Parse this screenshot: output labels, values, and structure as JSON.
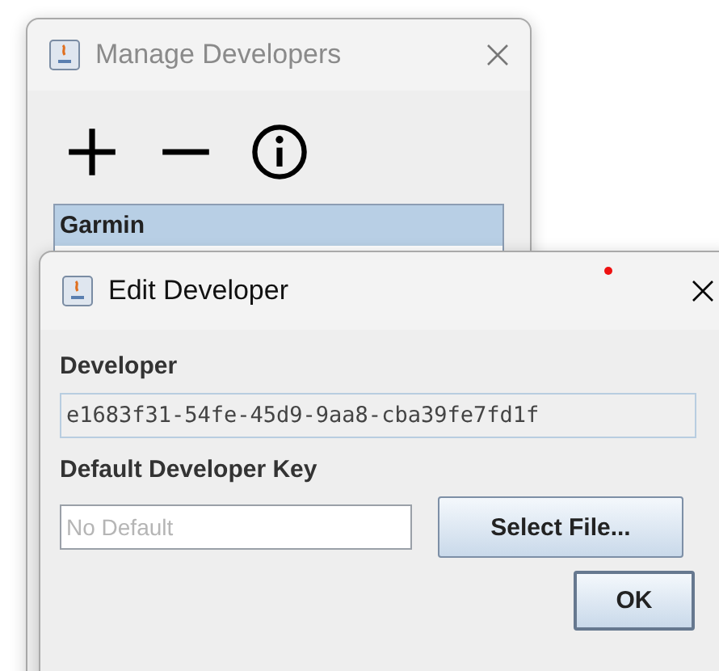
{
  "manage_window": {
    "title": "Manage Developers",
    "active": false,
    "developers": [
      {
        "name": "Garmin",
        "selected": true
      }
    ]
  },
  "edit_window": {
    "title": "Edit Developer",
    "active": true,
    "notification_dot": true,
    "developer_label": "Developer",
    "developer_value": "e1683f31-54fe-45d9-9aa8-cba39fe7fd1f",
    "key_label": "Default Developer Key",
    "key_field": {
      "placeholder": "No Default"
    },
    "select_button": "Select File...",
    "ok_button": "OK"
  }
}
